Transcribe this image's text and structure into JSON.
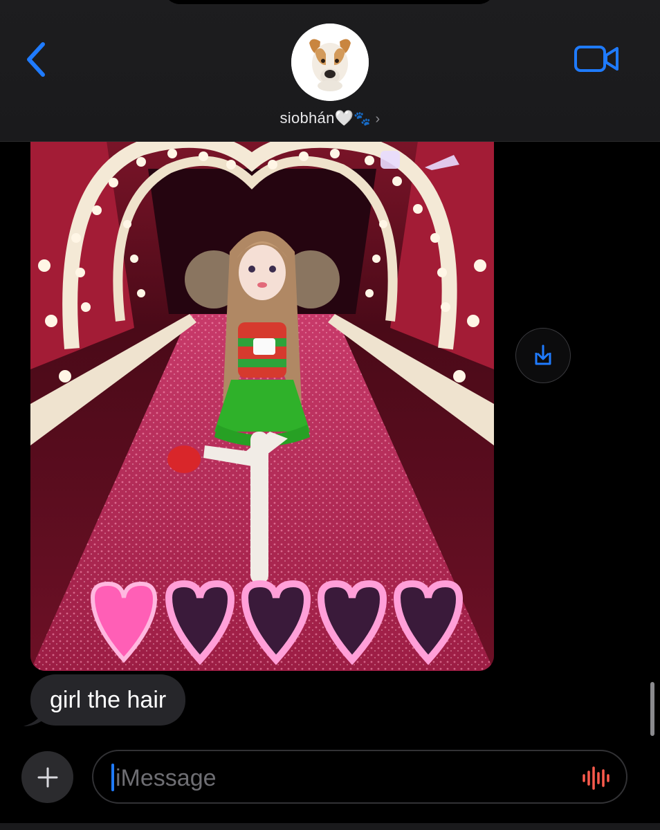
{
  "header": {
    "contact_name": "siobhán",
    "contact_heart": "🤍",
    "contact_paw": "🐾",
    "chevron": "›"
  },
  "messages": [
    {
      "type": "image",
      "sender": "incoming"
    },
    {
      "type": "text",
      "sender": "incoming",
      "text": "girl the hair"
    }
  ],
  "composer": {
    "placeholder": "iMessage",
    "plus_label": "+"
  },
  "colors": {
    "accent": "#1f7bff",
    "bubble_incoming": "#26262a",
    "mic": "#ff5b4d"
  },
  "icons": {
    "back": "chevron-left-icon",
    "video": "video-camera-icon",
    "save": "download-icon",
    "plus": "plus-icon",
    "mic": "audio-waveform-icon"
  }
}
